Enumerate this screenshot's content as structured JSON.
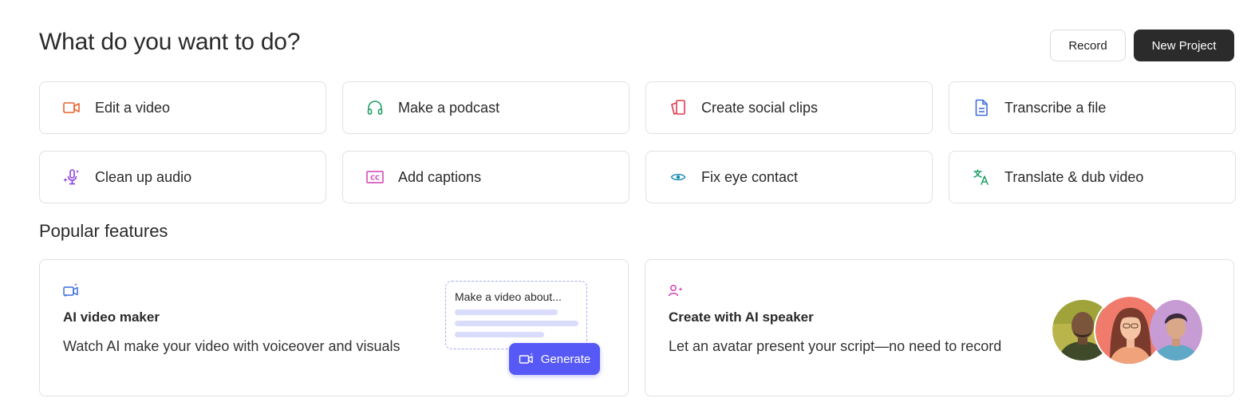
{
  "header": {
    "title": "What do you want to do?",
    "record_label": "Record",
    "new_project_label": "New Project"
  },
  "actions": [
    {
      "label": "Edit a video",
      "icon": "video-camera-icon",
      "color": "#e8632b"
    },
    {
      "label": "Make a podcast",
      "icon": "headphones-icon",
      "color": "#1f9d62"
    },
    {
      "label": "Create social clips",
      "icon": "social-clips-icon",
      "color": "#e03a4c"
    },
    {
      "label": "Transcribe a file",
      "icon": "document-icon",
      "color": "#3f6fe0"
    },
    {
      "label": "Clean up audio",
      "icon": "microphone-sparkle-icon",
      "color": "#8b3fe0"
    },
    {
      "label": "Add captions",
      "icon": "cc-icon",
      "color": "#d43fb5"
    },
    {
      "label": "Fix eye contact",
      "icon": "eye-icon",
      "color": "#1f8fb5"
    },
    {
      "label": "Translate & dub video",
      "icon": "translate-icon",
      "color": "#1f9d62"
    }
  ],
  "popular": {
    "title": "Popular features",
    "cards": [
      {
        "title": "AI video maker",
        "description": "Watch AI make your video with voiceover and visuals",
        "prompt_text": "Make a video about...",
        "button_label": "Generate",
        "accent": "#5659f5"
      },
      {
        "title": "Create with AI speaker",
        "description": "Let an avatar present your script—no need to record",
        "accent": "#d43fb5"
      }
    ]
  }
}
